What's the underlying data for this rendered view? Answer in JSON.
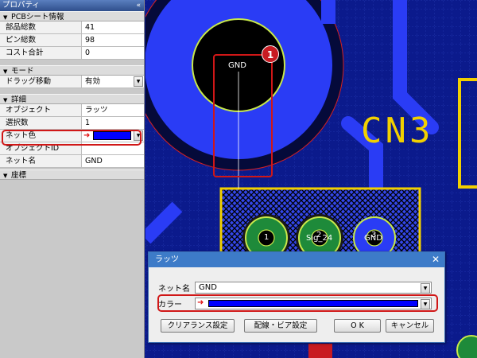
{
  "panel": {
    "title": "プロパティ",
    "collapse_glyph": "«",
    "sections": {
      "pcb": {
        "header": "PCBシート情報",
        "rows": [
          {
            "key": "部品総数",
            "value": "41"
          },
          {
            "key": "ピン総数",
            "value": "98"
          },
          {
            "key": "コスト合計",
            "value": "0"
          }
        ]
      },
      "mode": {
        "header": "モード",
        "rows": [
          {
            "key": "ドラッグ移動",
            "value": "有効"
          }
        ]
      },
      "detail": {
        "header": "詳細",
        "rows": [
          {
            "key": "オブジェクト",
            "value": "ラッツ"
          },
          {
            "key": "選択数",
            "value": "1"
          },
          {
            "key": "ネット色",
            "value": ""
          },
          {
            "key": "オブジェクトID",
            "value": ""
          },
          {
            "key": "ネット名",
            "value": "GND"
          }
        ]
      },
      "coords": {
        "header": "座標"
      }
    }
  },
  "canvas": {
    "gnd_label": "GND",
    "badge": "1",
    "cn3": "CN3",
    "pad1": "1",
    "pad2": "2",
    "pad2_net": "Sig_24",
    "pad3": "3",
    "pad3_net": "GND"
  },
  "dialog": {
    "title": "ラッツ",
    "close_glyph": "✕",
    "net_label": "ネット名",
    "net_value": "GND",
    "color_label": "カラー",
    "buttons": {
      "clearance": "クリアランス設定",
      "wiring": "配線・ビア設定",
      "ok": "O K",
      "cancel": "キャンセル"
    }
  },
  "colors": {
    "board_bg": "#0b1a8c",
    "copper_blue": "#2a3cf5",
    "silk_yellow": "#f2d000",
    "net_color": "#0000ff",
    "highlight_red": "#d01717",
    "pad_green": "#1e8a3a"
  },
  "icons": {
    "arrow": "➜",
    "dropdown": "▼",
    "section_open": "▼",
    "section_closed": "▼"
  }
}
